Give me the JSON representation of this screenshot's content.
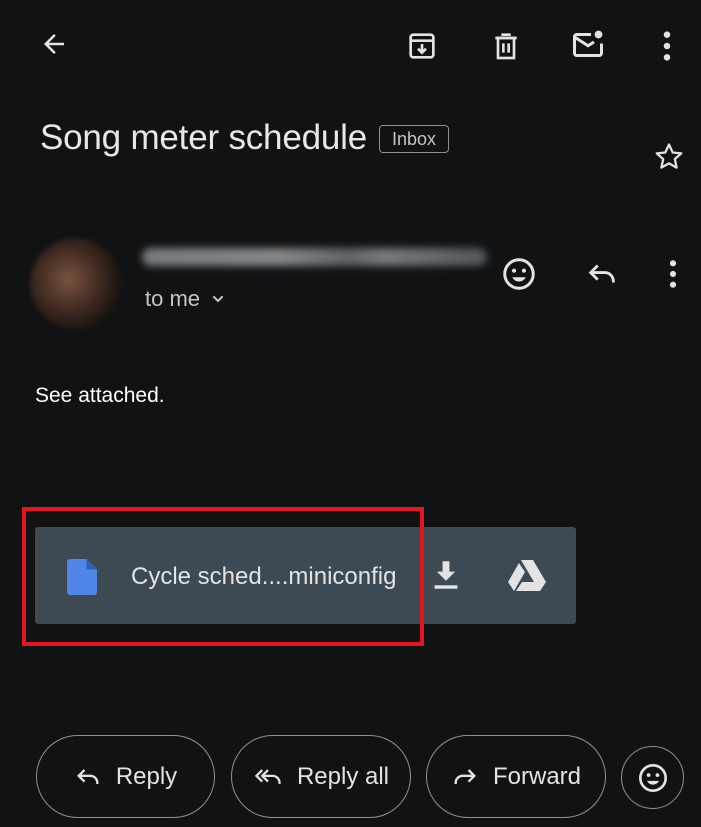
{
  "toolbar": {
    "back_icon": "arrow-back-icon",
    "archive_icon": "archive-icon",
    "delete_icon": "trash-icon",
    "mark_unread_icon": "mail-unread-icon",
    "more_icon": "more-vert-icon"
  },
  "email": {
    "subject": "Song meter schedule",
    "label": "Inbox",
    "recipient": "to me",
    "body": "See attached."
  },
  "attachment": {
    "file_name": "Cycle sched....miniconfig",
    "file_icon": "document-icon",
    "download_icon": "download-icon",
    "drive_icon": "drive-icon"
  },
  "actions": {
    "reply": "Reply",
    "reply_all": "Reply all",
    "forward": "Forward"
  },
  "colors": {
    "background": "#101214",
    "attachment_bg": "#3d4a54",
    "file_icon": "#4f86e8",
    "highlight": "#e8141c"
  }
}
